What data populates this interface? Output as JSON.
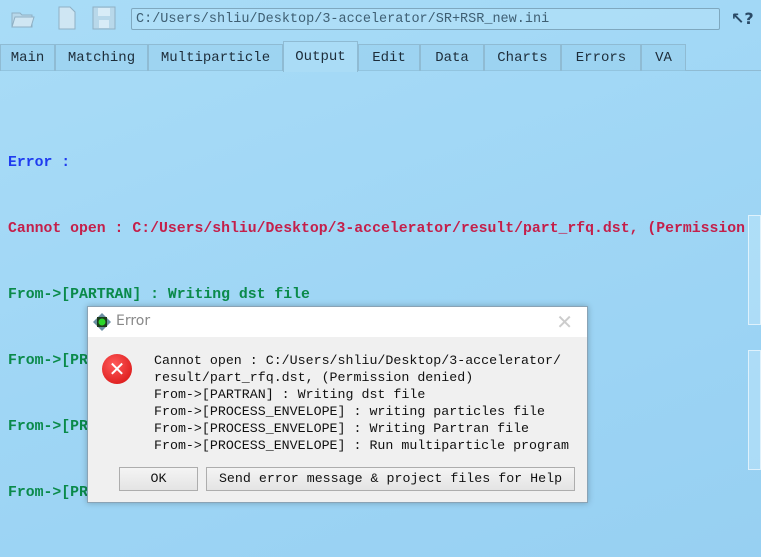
{
  "toolbar": {
    "file_path": "C:/Users/shliu/Desktop/3-accelerator/SR+RSR_new.ini",
    "icons": [
      "open-folder-icon",
      "new-file-icon",
      "save-icon",
      "context-help-icon"
    ]
  },
  "tabs": [
    {
      "label": "Main"
    },
    {
      "label": "Matching"
    },
    {
      "label": "Multiparticle"
    },
    {
      "label": "Output",
      "active": true
    },
    {
      "label": "Edit"
    },
    {
      "label": "Data"
    },
    {
      "label": "Charts"
    },
    {
      "label": "Errors"
    },
    {
      "label": "VA"
    }
  ],
  "output": {
    "lines": [
      "Error :",
      "Cannot open : C:/Users/shliu/Desktop/3-accelerator/result/part_rfq.dst, (Permission",
      "From->[PARTRAN] : Writing dst file",
      "From->[PROCESS_ENVELOPE] : writing particles file",
      "From->[PROCESS_ENVELOPE] : Writing Partran file",
      "From->[PROCESS_ENVELOPE] : Run multiparticle program"
    ]
  },
  "colors": {
    "error_heading": "#1f3cf0",
    "error_line": "#c41f4a",
    "trace_line": "#0a8a4a"
  },
  "dialog": {
    "title": "Error",
    "message": "Cannot open : C:/Users/shliu/Desktop/3-accelerator/\nresult/part_rfq.dst, (Permission denied)\nFrom->[PARTRAN] : Writing dst file\nFrom->[PROCESS_ENVELOPE] : writing particles file\nFrom->[PROCESS_ENVELOPE] : Writing Partran file\nFrom->[PROCESS_ENVELOPE] : Run multiparticle program",
    "ok_label": "OK",
    "help_label": "Send error message & project files for Help"
  }
}
